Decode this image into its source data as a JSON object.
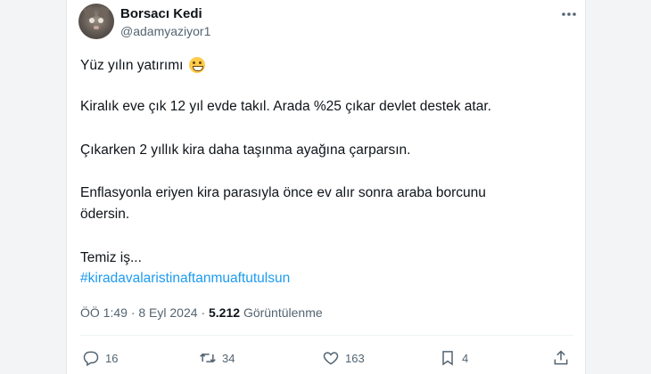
{
  "author": {
    "name": "Borsacı Kedi",
    "handle": "@adamyaziyor1"
  },
  "tweet": {
    "line1": "Yüz yılın yatırımı",
    "line1_emoji": "grinning-face-emoji",
    "para2": "Kiralık eve çık 12 yıl evde takıl. Arada %25 çıkar devlet destek atar.",
    "para3": "Çıkarken 2 yıllık kira daha taşınma ayağına çarparsın.",
    "para4_line1": "Enflasyonla eriyen kira parasıyla önce ev alır sonra araba borcunu",
    "para4_line2": "ödersin.",
    "para5": "Temiz iş...",
    "hashtag": "#kiradavalaristinaftanmuaftutulsun"
  },
  "meta": {
    "time": "ÖÖ 1:49",
    "separator": "·",
    "date": "8 Eyl 2024",
    "views_count": "5.212",
    "views_label": "Görüntülenme"
  },
  "actions": {
    "replies": "16",
    "reposts": "34",
    "likes": "163",
    "bookmarks": "4"
  },
  "colors": {
    "accent": "#1d9bf0",
    "text": "#0f1419",
    "secondary": "#536471"
  }
}
